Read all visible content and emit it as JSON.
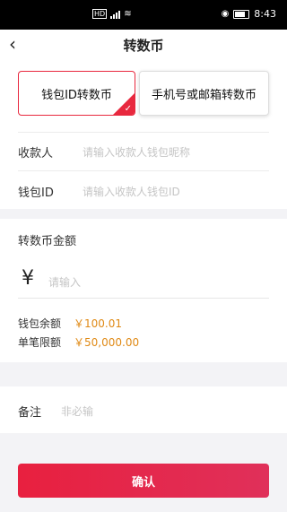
{
  "status_bar": {
    "network": "HD",
    "time": "8:43"
  },
  "header": {
    "back_icon": "chevron-left-icon",
    "title": "转数币"
  },
  "tabs": [
    {
      "label": "钱包ID转数币",
      "active": true
    },
    {
      "label": "手机号或邮箱转数币",
      "active": false
    }
  ],
  "form": {
    "payee_label": "收款人",
    "payee_placeholder": "请输入收款人钱包昵称",
    "wallet_label": "钱包ID",
    "wallet_placeholder": "请输入收款人钱包ID"
  },
  "amount": {
    "title": "转数币金额",
    "currency_symbol": "¥",
    "placeholder": "请输入",
    "balance_label": "钱包余额",
    "balance_value": "￥100.01",
    "limit_label": "单笔限额",
    "limit_value": "￥50,000.00"
  },
  "note": {
    "label": "备注",
    "placeholder": "非必输"
  },
  "confirm_label": "确认",
  "colors": {
    "accent": "#e8283e",
    "amount_value": "#e08a16"
  }
}
